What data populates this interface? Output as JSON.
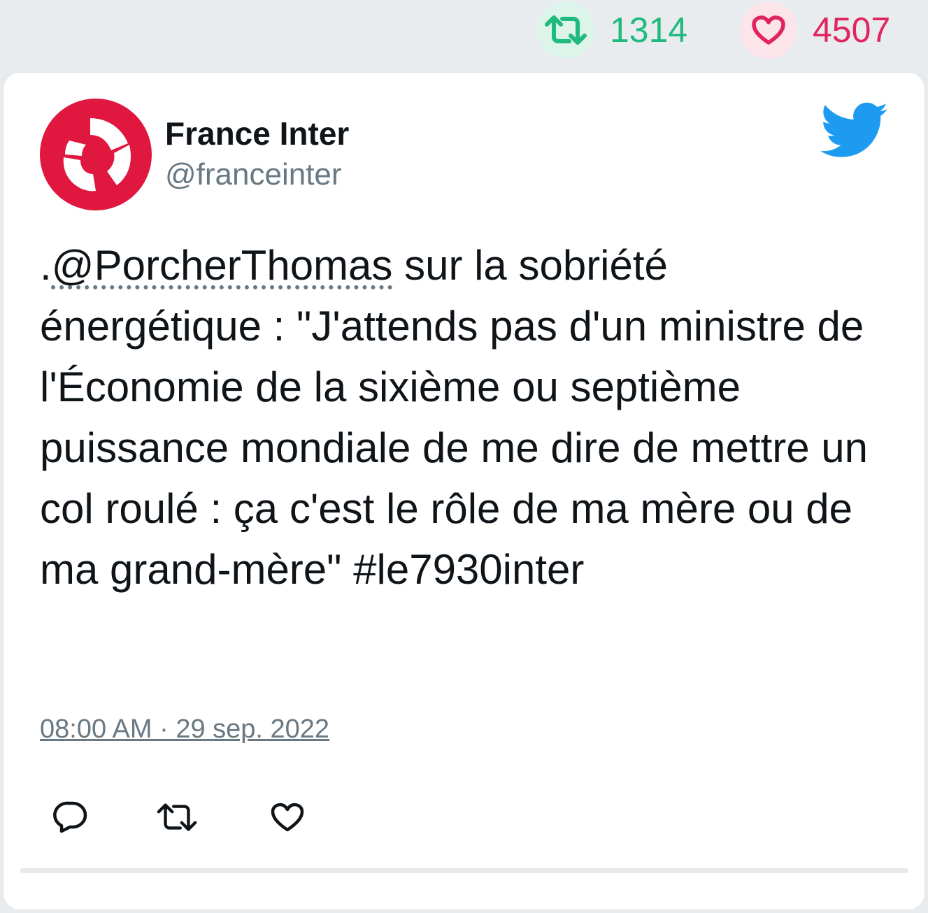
{
  "stats": {
    "retweet_count": "1314",
    "like_count": "4507",
    "retweet_icon": "retweet-icon",
    "like_icon": "heart-icon",
    "retweet_color": "#1fba7e",
    "like_color": "#e0245e"
  },
  "tweet": {
    "author_name": "France Inter",
    "author_handle": "@franceinter",
    "text_prefix": ".",
    "mention": "@PorcherThomas",
    "text_body": " sur la sobriété énergétique : \"J'attends pas d'un ministre de l'Économie de la sixième ou septième puissance mondiale de me dire de mettre un col roulé : ça c'est le rôle de ma mère ou de ma grand-mère\" #le7930inter",
    "timestamp": "08:00 AM · 29 sep. 2022",
    "brand_color": "#e0173e",
    "twitter_blue": "#1d9bf0"
  },
  "actions": [
    "reply-icon",
    "retweet-icon",
    "like-icon"
  ]
}
